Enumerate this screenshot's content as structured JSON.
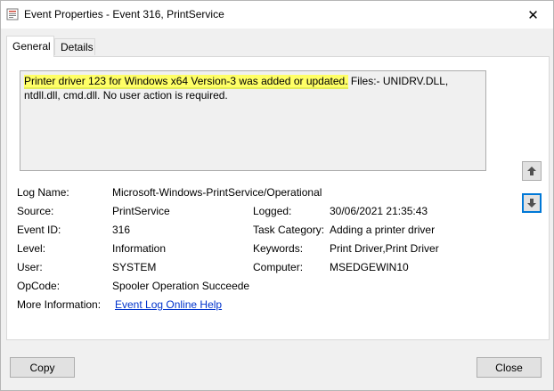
{
  "window": {
    "title": "Event Properties - Event 316, PrintService",
    "close_glyph": "✕"
  },
  "tabs": [
    {
      "label": "General",
      "active": true
    },
    {
      "label": "Details",
      "active": false
    }
  ],
  "description": {
    "highlighted": "Printer driver 123 for Windows x64 Version-3 was added or updated.",
    "rest": " Files:- UNIDRV.DLL, ntdll.dll, cmd.dll. No user action is required.",
    "highlight_color": "#ffff66"
  },
  "fields": {
    "log_name": {
      "label": "Log Name:",
      "value": "Microsoft-Windows-PrintService/Operational"
    },
    "source": {
      "label": "Source:",
      "value": "PrintService"
    },
    "logged": {
      "label": "Logged:",
      "value": "30/06/2021 21:35:43"
    },
    "event_id": {
      "label": "Event ID:",
      "value": "316"
    },
    "task_category": {
      "label": "Task Category:",
      "value": "Adding a printer driver"
    },
    "level": {
      "label": "Level:",
      "value": "Information"
    },
    "keywords": {
      "label": "Keywords:",
      "value": "Print Driver,Print Driver"
    },
    "user": {
      "label": "User:",
      "value": "SYSTEM"
    },
    "computer": {
      "label": "Computer:",
      "value": "MSEDGEWIN10"
    },
    "opcode": {
      "label": "OpCode:",
      "value": "Spooler Operation Succeede"
    },
    "more_info": {
      "label": "More Information:",
      "value": "Event Log Online Help"
    }
  },
  "buttons": {
    "copy": "Copy",
    "close": "Close"
  },
  "icons": {
    "app": "event-viewer-icon",
    "up": "arrow-up-icon",
    "down": "arrow-down-icon",
    "close": "close-icon"
  }
}
